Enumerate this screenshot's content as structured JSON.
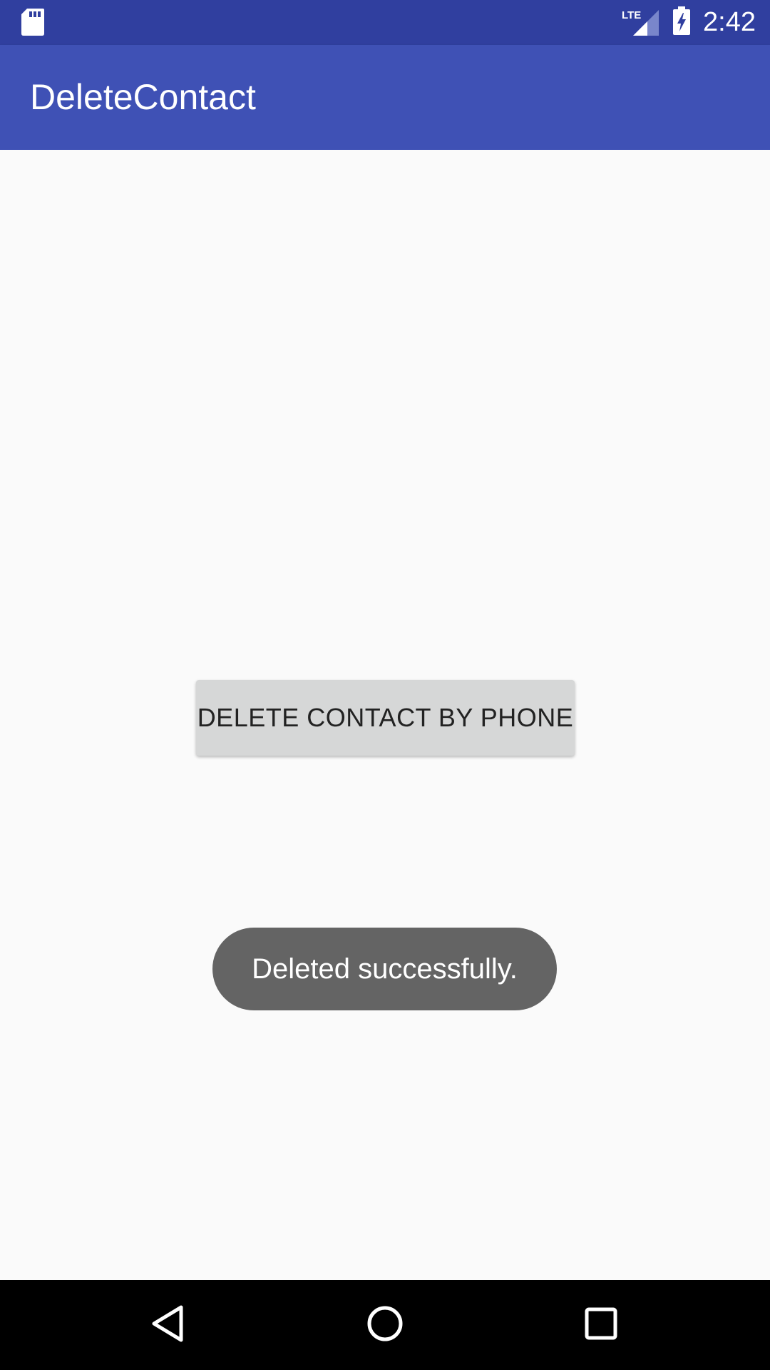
{
  "status_bar": {
    "time": "2:42",
    "network_label": "LTE",
    "icons": [
      "sd-card-icon",
      "lte-signal-icon",
      "battery-charging-icon"
    ]
  },
  "app_bar": {
    "title": "DeleteContact",
    "color": "#3f51b5"
  },
  "main": {
    "button_label": "DELETE CONTACT BY PHONE"
  },
  "toast": {
    "message": "Deleted successfully."
  },
  "nav_bar": {
    "icons": [
      "back-icon",
      "home-icon",
      "recents-icon"
    ]
  },
  "colors": {
    "status_bar": "#303f9f",
    "app_bar": "#3f51b5",
    "background": "#fafafa",
    "button": "#d6d7d7",
    "toast": "#646464"
  }
}
